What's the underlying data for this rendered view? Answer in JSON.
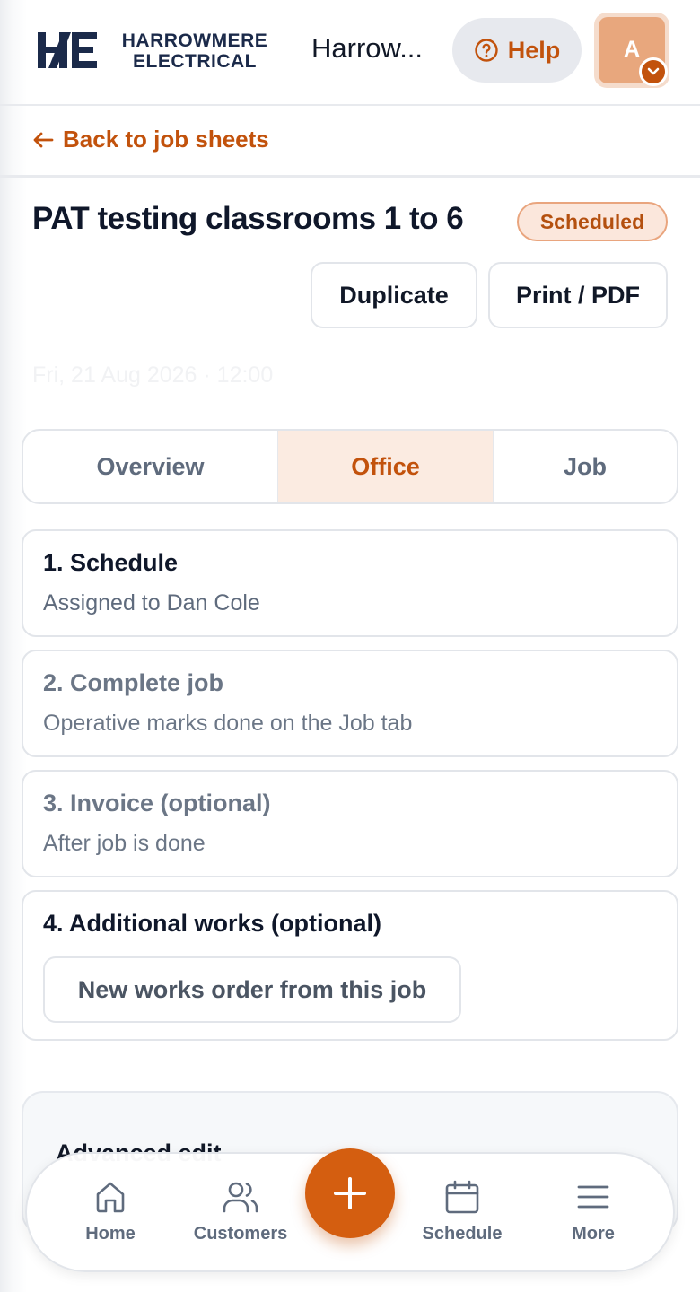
{
  "header": {
    "logo_text_line1": "HARROWMERE",
    "logo_text_line2": "ELECTRICAL",
    "company_name": "Harrow...",
    "help_label": "Help",
    "avatar_initial": "A"
  },
  "nav": {
    "back_label": "Back to job sheets"
  },
  "job": {
    "title": "PAT testing classrooms 1 to 6",
    "status": "Scheduled",
    "duplicate_label": "Duplicate",
    "print_label": "Print / PDF",
    "date_faded": "Fri, 21 Aug 2026 · 12:00"
  },
  "tabs": [
    {
      "label": "Overview",
      "active": false
    },
    {
      "label": "Office",
      "active": true
    },
    {
      "label": "Job",
      "active": false
    }
  ],
  "steps": [
    {
      "title": "1. Schedule",
      "subtitle": "Assigned to Dan Cole",
      "active": true
    },
    {
      "title": "2. Complete job",
      "subtitle": "Operative marks done on the Job tab",
      "active": false
    },
    {
      "title": "3. Invoice (optional)",
      "subtitle": "After job is done",
      "active": false
    },
    {
      "title": "4. Additional works (optional)",
      "button_label": "New works order from this job",
      "active": true
    }
  ],
  "advanced": {
    "title": "Advanced edit"
  },
  "bottom_nav": {
    "home": "Home",
    "customers": "Customers",
    "schedule": "Schedule",
    "more": "More"
  },
  "colors": {
    "accent": "#c2520c",
    "fab": "#d45e10",
    "navy": "#1b2a4a"
  }
}
